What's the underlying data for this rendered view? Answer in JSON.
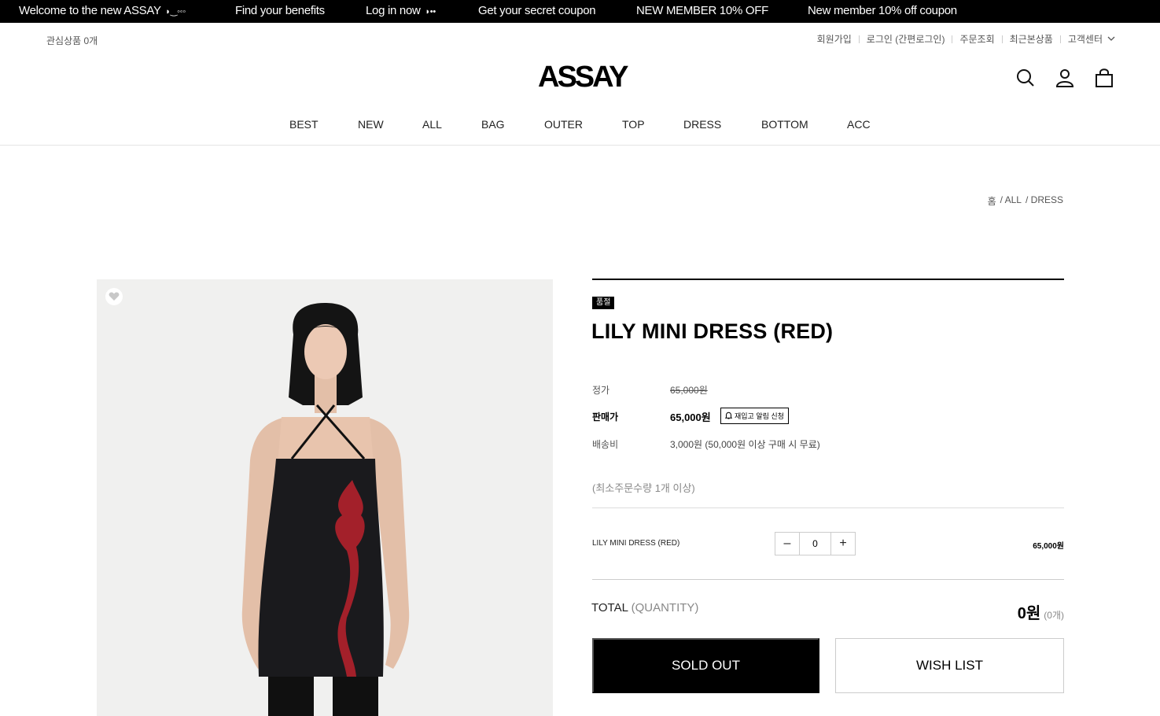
{
  "ticker": [
    {
      "text": "Welcome to the new ASSAY",
      "glyph": "◗‿◦◦◦"
    },
    {
      "text": "Find your benefits",
      "glyph": ""
    },
    {
      "text": "Log in now",
      "glyph": "◗••"
    },
    {
      "text": "Get your secret coupon",
      "glyph": ""
    },
    {
      "text": "NEW MEMBER 10% OFF",
      "glyph": ""
    },
    {
      "text": "New member 10% off coupon",
      "glyph": ""
    }
  ],
  "utility": {
    "wishlist_count": "관심상품 0개",
    "links": [
      "회원가입",
      "로그인 (간편로그인)",
      "주문조회",
      "최근본상품",
      "고객센터"
    ]
  },
  "logo": "ASSAY",
  "header_icons": [
    "search-icon",
    "account-icon",
    "cart-icon"
  ],
  "nav": [
    "BEST",
    "NEW",
    "ALL",
    "BAG",
    "OUTER",
    "TOP",
    "DRESS",
    "BOTTOM",
    "ACC"
  ],
  "breadcrumb": [
    "홈",
    "/ ALL",
    "/ DRESS"
  ],
  "product": {
    "tag": "품절",
    "title": "LILY MINI DRESS (RED)",
    "list_price_label": "정가",
    "list_price": "65,000원",
    "sale_price_label": "판매가",
    "sale_price": "65,000원",
    "restock_label": "재입고 알림 신청",
    "shipping_label": "배송비",
    "shipping": "3,000원 (50,000원 이상 구매 시 무료)",
    "min_qty": "(최소주문수량 1개 이상)",
    "option_name": "LILY MINI DRESS (RED)",
    "quantity": "0",
    "option_price": "65,000원"
  },
  "total": {
    "label": "TOTAL",
    "sub": "(QUANTITY)",
    "amount": "0원",
    "count": "(0개)"
  },
  "buttons": {
    "sold_out": "SOLD OUT",
    "wish_list": "WISH LIST"
  },
  "colors": {
    "accent": "#000000",
    "dress_print": "#a3202a",
    "photo_bg": "#f0f0ef"
  }
}
